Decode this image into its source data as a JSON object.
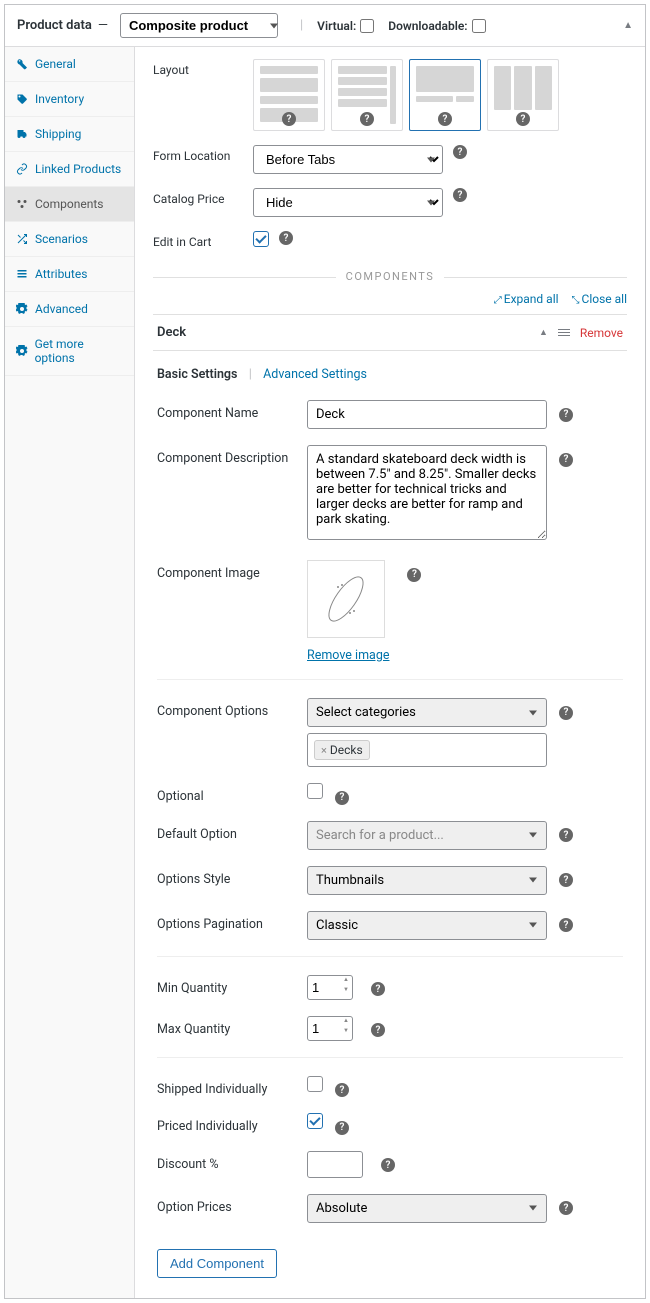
{
  "header": {
    "title_prefix": "Product data",
    "dash": "—",
    "product_type": "Composite product",
    "virtual_label": "Virtual:",
    "downloadable_label": "Downloadable:",
    "virtual_checked": false,
    "downloadable_checked": false
  },
  "sidebar": {
    "items": [
      {
        "label": "General",
        "icon": "wrench"
      },
      {
        "label": "Inventory",
        "icon": "tag"
      },
      {
        "label": "Shipping",
        "icon": "truck"
      },
      {
        "label": "Linked Products",
        "icon": "link"
      },
      {
        "label": "Components",
        "icon": "cluster",
        "active": true
      },
      {
        "label": "Scenarios",
        "icon": "shuffle"
      },
      {
        "label": "Attributes",
        "icon": "list"
      },
      {
        "label": "Advanced",
        "icon": "gear"
      },
      {
        "label": "Get more options",
        "icon": "gear"
      }
    ]
  },
  "layout": {
    "label": "Layout",
    "selected_index": 2
  },
  "form_location": {
    "label": "Form Location",
    "value": "Before Tabs"
  },
  "catalog_price": {
    "label": "Catalog Price",
    "value": "Hide"
  },
  "edit_in_cart": {
    "label": "Edit in Cart",
    "checked": true
  },
  "components_heading": "COMPONENTS",
  "expand_all": "Expand all",
  "close_all": "Close all",
  "component": {
    "title": "Deck",
    "remove_label": "Remove",
    "tabs": {
      "basic": "Basic Settings",
      "advanced": "Advanced Settings"
    },
    "name": {
      "label": "Component Name",
      "value": "Deck"
    },
    "description": {
      "label": "Component Description",
      "value": "A standard skateboard deck width is between 7.5\" and 8.25\". Smaller decks are better for technical tricks and larger decks are better for ramp and park skating."
    },
    "image": {
      "label": "Component Image",
      "remove_label": "Remove image"
    },
    "options": {
      "label": "Component Options",
      "select_value": "Select categories",
      "tags": [
        "Decks"
      ]
    },
    "optional": {
      "label": "Optional",
      "checked": false
    },
    "default_option": {
      "label": "Default Option",
      "placeholder": "Search for a product..."
    },
    "options_style": {
      "label": "Options Style",
      "value": "Thumbnails"
    },
    "options_pagination": {
      "label": "Options Pagination",
      "value": "Classic"
    },
    "min_quantity": {
      "label": "Min Quantity",
      "value": "1"
    },
    "max_quantity": {
      "label": "Max Quantity",
      "value": "1"
    },
    "shipped_individually": {
      "label": "Shipped Individually",
      "checked": false
    },
    "priced_individually": {
      "label": "Priced Individually",
      "checked": true
    },
    "discount": {
      "label": "Discount %",
      "value": ""
    },
    "option_prices": {
      "label": "Option Prices",
      "value": "Absolute"
    }
  },
  "add_component": "Add Component"
}
